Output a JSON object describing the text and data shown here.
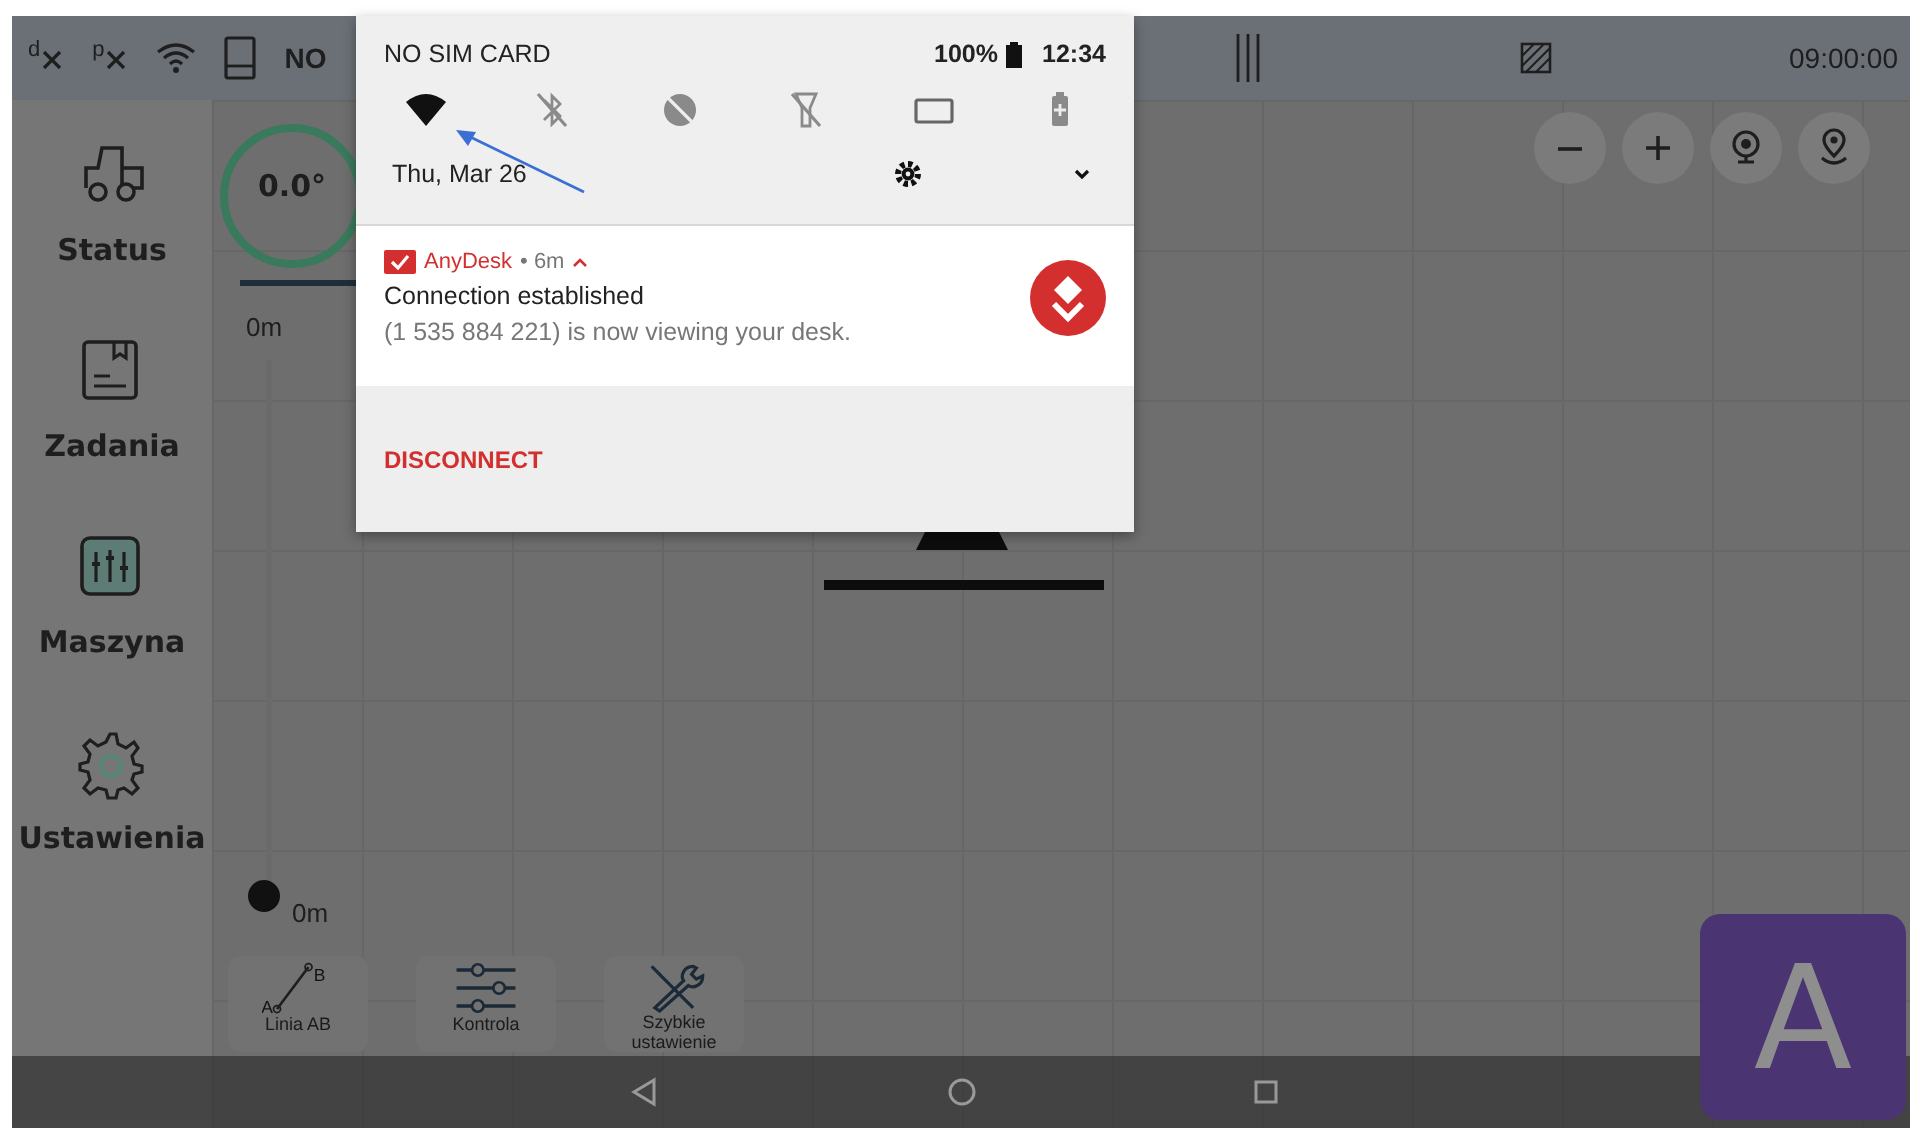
{
  "status_bar": {
    "items": [
      {
        "kind": "data",
        "label": "d"
      },
      {
        "kind": "data",
        "label": "p"
      },
      {
        "kind": "wifi"
      },
      {
        "kind": "tablet"
      }
    ],
    "carrier": "NO",
    "clock": "09:00:00"
  },
  "sidebar": {
    "items": [
      {
        "kind": "status",
        "label": "Status"
      },
      {
        "kind": "tasks",
        "label": "Zadania"
      },
      {
        "kind": "machine",
        "label": "Maszyna"
      },
      {
        "kind": "settings",
        "label": "Ustawienia"
      }
    ]
  },
  "gauge": {
    "reading": "0.0°"
  },
  "scale": {
    "top_label": "0m",
    "bottom_label": "0m"
  },
  "map_controls": [
    {
      "kind": "zoom_out"
    },
    {
      "kind": "zoom_in"
    },
    {
      "kind": "camera"
    },
    {
      "kind": "location"
    }
  ],
  "tools": [
    {
      "kind": "line_ab",
      "label": "Linia AB",
      "points": [
        "A",
        "B"
      ]
    },
    {
      "kind": "sliders",
      "label": "Kontrola"
    },
    {
      "kind": "tools",
      "label": "Szybkie ustawienie"
    }
  ],
  "fab": {
    "label": "A"
  },
  "notification_shade": {
    "carrier": "NO SIM CARD",
    "battery": "100%",
    "clock": "12:34",
    "quick_settings": [
      {
        "kind": "wifi",
        "on": true
      },
      {
        "kind": "bluetooth",
        "on": false
      },
      {
        "kind": "do_not_disturb",
        "on": false
      },
      {
        "kind": "flashlight",
        "on": false
      },
      {
        "kind": "rotate",
        "on": false
      },
      {
        "kind": "battery_saver",
        "on": false
      }
    ],
    "date": "Thu, Mar 26",
    "notifications": [
      {
        "app": "AnyDesk",
        "time": "• 6m",
        "title": "Connection established",
        "text": "(1 535 884 221) is now viewing your desk.",
        "actions": [
          "DISCONNECT"
        ]
      }
    ]
  }
}
